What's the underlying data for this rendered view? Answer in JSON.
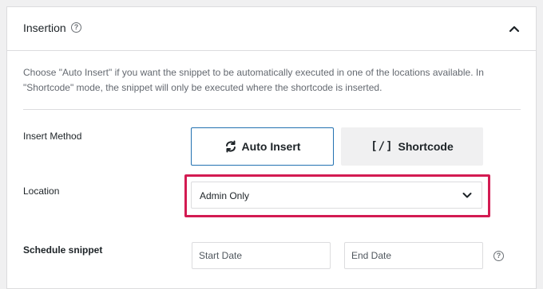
{
  "panel": {
    "title": "Insertion",
    "description": "Choose \"Auto Insert\" if you want the snippet to be automatically executed in one of the locations available. In \"Shortcode\" mode, the snippet will only be executed where the shortcode is inserted."
  },
  "insert_method": {
    "label": "Insert Method",
    "auto_insert_label": "Auto Insert",
    "shortcode_label": "Shortcode",
    "shortcode_icon_text": "[/]",
    "selected": "Auto Insert"
  },
  "location": {
    "label": "Location",
    "selected_value": "Admin Only"
  },
  "schedule": {
    "label": "Schedule snippet",
    "start_placeholder": "Start Date",
    "end_placeholder": "End Date"
  },
  "colors": {
    "accent": "#2271b1",
    "highlight": "#d31b52",
    "border": "#dcdcde"
  },
  "icons": {
    "help": "question-circle-icon",
    "collapse": "chevron-up-icon",
    "auto_insert": "refresh-icon",
    "dropdown": "chevron-down-icon"
  }
}
